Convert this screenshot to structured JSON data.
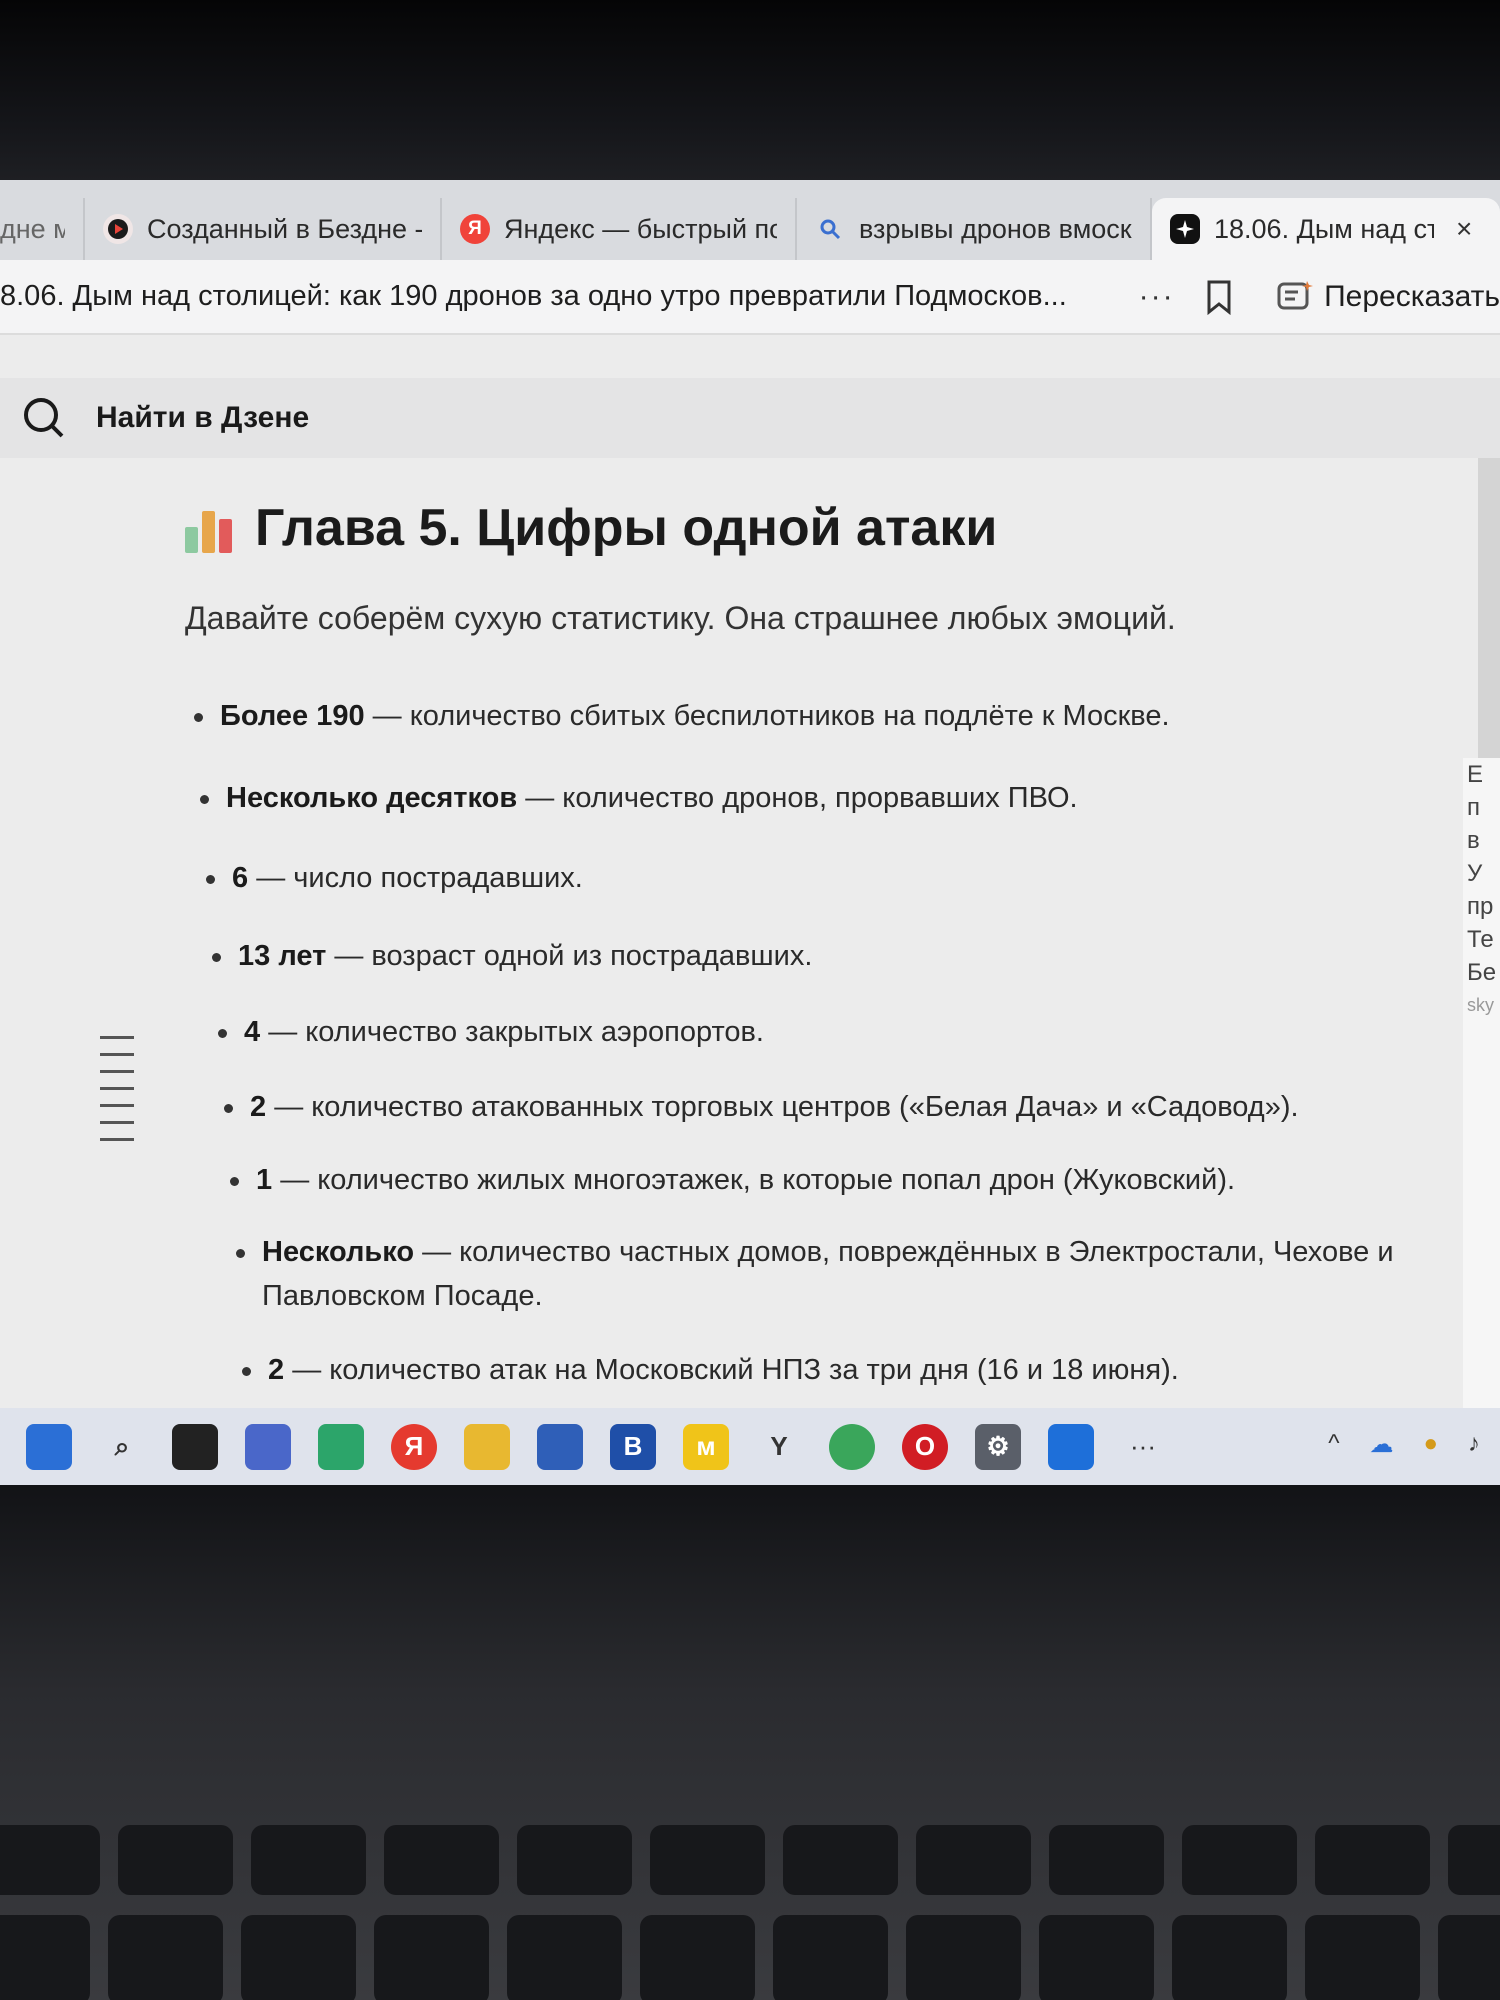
{
  "browser": {
    "tabs": [
      {
        "label": "дне м",
        "icon": "dzen-icon",
        "active": false
      },
      {
        "label": "Созданный в Бездне -",
        "icon": "dzen-icon",
        "active": false
      },
      {
        "label": "Яндекс — быстрый по",
        "icon": "yandex-icon",
        "active": false
      },
      {
        "label": "взрывы дронов вмоск",
        "icon": "search-icon",
        "active": false
      },
      {
        "label": "18.06. Дым над сто",
        "icon": "ai-icon",
        "active": true
      }
    ],
    "close_symbol": "×",
    "address_title": "8.06. Дым над столицей: как 190 дронов за одно утро превратили Подмосков...",
    "more_symbol": "···",
    "retell_label": "Пересказать"
  },
  "dzen": {
    "search_label": "Найти в Дзене"
  },
  "article": {
    "chapter_title": "Глава 5. Цифры одной атаки",
    "lead": "Давайте соберём сухую статистику. Она страшнее любых эмоций.",
    "items": [
      {
        "bold": "Более 190",
        "text": " — количество сбитых беспилотников на подлёте к Москве."
      },
      {
        "bold": "Несколько десятков",
        "text": " — количество дронов, прорвавших ПВО."
      },
      {
        "bold": "6",
        "text": " — число пострадавших."
      },
      {
        "bold": "13 лет",
        "text": " — возраст одной из пострадавших."
      },
      {
        "bold": "4",
        "text": " — количество закрытых аэропортов."
      },
      {
        "bold": "2",
        "text": " — количество атакованных торговых центров («Белая Дача» и «Садовод»)."
      },
      {
        "bold": "1",
        "text": " — количество жилых многоэтажек, в которые попал дрон (Жуковский)."
      },
      {
        "bold": "Несколько",
        "text": " — количество частных домов, повреждённых в Электростали, Чехове и Павловском Посаде."
      },
      {
        "bold": "2",
        "text": " — количество атак на Московский НПЗ за три дня (16 и 18 июня)."
      }
    ]
  },
  "side_panel": {
    "fragments": [
      "Е",
      "п",
      "в",
      "У",
      "пр",
      "Те",
      "Бе",
      "sky"
    ]
  },
  "taskbar": {
    "apps": [
      {
        "name": "start-icon",
        "label": "",
        "color": "#2b6fd6"
      },
      {
        "name": "search-icon",
        "label": "⌕",
        "color": "#dfe3ec"
      },
      {
        "name": "file-icon",
        "label": "",
        "color": "#222"
      },
      {
        "name": "widgets-icon",
        "label": "",
        "color": "#4a67c9"
      },
      {
        "name": "edge-icon",
        "label": "",
        "color": "#2ca56a"
      },
      {
        "name": "yandex-icon",
        "label": "Я",
        "color": "#e53a2f"
      },
      {
        "name": "folder-icon",
        "label": "",
        "color": "#e8b830"
      },
      {
        "name": "store-icon",
        "label": "",
        "color": "#2f5fb8"
      },
      {
        "name": "b-app-icon",
        "label": "B",
        "color": "#1f4fa8"
      },
      {
        "name": "miro-icon",
        "label": "м",
        "color": "#f0c419"
      },
      {
        "name": "yandex-browser-icon",
        "label": "Y",
        "color": "#dfe3ec"
      },
      {
        "name": "chrome-icon",
        "label": "",
        "color": "#3aa65b"
      },
      {
        "name": "opera-icon",
        "label": "O",
        "color": "#d11d24"
      },
      {
        "name": "settings-icon",
        "label": "⚙",
        "color": "#5a5f69"
      },
      {
        "name": "app-icon",
        "label": "",
        "color": "#1e6fd9"
      }
    ],
    "more_symbol": "···",
    "tray_chevron": "^"
  }
}
